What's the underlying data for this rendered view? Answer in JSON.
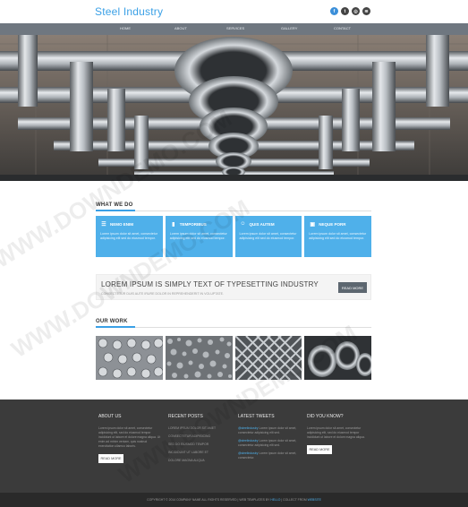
{
  "header": {
    "brand": "Steel Industry",
    "social": [
      {
        "icon": "facebook-icon",
        "glyph": "f",
        "color": "#3b8fd9"
      },
      {
        "icon": "twitter-icon",
        "glyph": "t",
        "color": "#444444"
      },
      {
        "icon": "dribbble-icon",
        "glyph": "◎",
        "color": "#444444"
      },
      {
        "icon": "rss-icon",
        "glyph": "≋",
        "color": "#444444"
      }
    ]
  },
  "nav": [
    "HOME",
    "ABOUT",
    "SERVICES",
    "GALLERY",
    "CONTACT"
  ],
  "what_we_do": {
    "title": "WHAT WE DO",
    "boxes": [
      {
        "icon": "stack-icon",
        "glyph": "☰",
        "title": "NEMO ENIM",
        "text": "Lorem ipsum dolor sit amet, consectetur adipisicing elit sed do eiusmod tempor."
      },
      {
        "icon": "bars-icon",
        "glyph": "▮",
        "title": "TEMPORIBUS",
        "text": "Lorem ipsum dolor sit amet, consectetur adipisicing elit sed do eiusmod tempor."
      },
      {
        "icon": "people-icon",
        "glyph": "☺",
        "title": "QUIS AUTEM",
        "text": "Lorem ipsum dolor sit amet, consectetur adipisicing elit sed do eiusmod tempor."
      },
      {
        "icon": "truck-icon",
        "glyph": "▣",
        "title": "NEQUE PORR",
        "text": "Lorem ipsum dolor sit amet, consectetur adipisicing elit sed do eiusmod tempor."
      }
    ]
  },
  "banner": {
    "title": "LOREM IPSUM IS SIMPLY TEXT OF TYPESETTING INDUSTRY",
    "subtitle": "CONSECTETUR DUIS AUTE IRURE DOLOR IN REPREHENDERIT IN VOLUPTATE.",
    "button": "READ MORE"
  },
  "our_work": {
    "title": "OUR WORK",
    "tiles": [
      "gallery-image-bolts",
      "gallery-image-gravel",
      "gallery-image-mesh",
      "gallery-image-pipes"
    ]
  },
  "footer": {
    "about": {
      "title": "ABOUT US",
      "text": "Lorem ipsum dolor sit amet, consectetur adipisicing elit, sed do eiusmod tempor incididunt ut labore et dolore magna aliqua. Ut enim ad minim veniam, quis nostrud exercitation ullamco laboris.",
      "button": "READ MORE"
    },
    "recent_posts": {
      "title": "RECENT POSTS",
      "items": [
        "LOREM IPSUM DOLOR SIT AMET",
        "CONSECTETUR ADIPISICING",
        "SED DO EIUSMOD TEMPOR",
        "INCIDIDUNT UT LABORE ET",
        "DOLORE MAGNA ALIQUA"
      ]
    },
    "tweets": {
      "title": "LATEST TWEETS",
      "items": [
        {
          "handle": "@steelindustry",
          "text": "Lorem ipsum dolor sit amet, consectetur adipisicing elit sed."
        },
        {
          "handle": "@steelindustry",
          "text": "Lorem ipsum dolor sit amet, consectetur adipisicing elit sed."
        },
        {
          "handle": "@steelindustry",
          "text": "Lorem ipsum dolor sit amet, consectetur."
        }
      ]
    },
    "did_you_know": {
      "title": "DID YOU KNOW?",
      "text": "Lorem ipsum dolor sit amet, consectetur adipisicing elit, sed do eiusmod tempor incididunt ut labore et dolore magna aliqua.",
      "button": "READ MORE"
    }
  },
  "copyright": {
    "text": "COPYRIGHT © 2014 COMPANY NAME ALL RIGHTS RESERVED | WEB TEMPLATES BY",
    "link1": "HELLO",
    "mid": " | COLLECT FROM ",
    "link2": "WEBSITE"
  },
  "watermark": "WWW.DOWNDEMO.COM",
  "colors": {
    "accent": "#3aa0e6",
    "box": "#4fb0ea",
    "nav": "#6f7780",
    "footer": "#3b3b3b"
  }
}
